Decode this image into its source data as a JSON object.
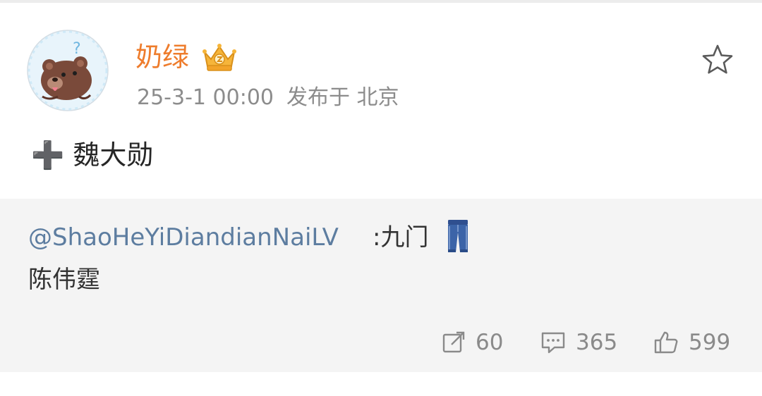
{
  "post": {
    "author_name": "奶绿",
    "timestamp": "25-3-1 00:00",
    "location": "发布于 北京",
    "text": "➕ 魏大勋"
  },
  "repost": {
    "author_handle": "@ShaoHeYiDiandianNaiLV",
    "text_inline": ":九门",
    "text_line2": "陈伟霆"
  },
  "actions": {
    "repost_count": "60",
    "comment_count": "365",
    "like_count": "599"
  },
  "colors": {
    "username": "#ee7c2c",
    "link": "#5d7da0",
    "muted": "#8a8a8a",
    "repost_bg": "#f4f4f4"
  },
  "icons": {
    "avatar": "bear-avatar",
    "badge": "vip-crown-icon",
    "star": "star-icon",
    "repost": "repost-icon",
    "comment": "comment-icon",
    "like": "thumbs-up-icon",
    "emoji": "jeans-icon"
  }
}
